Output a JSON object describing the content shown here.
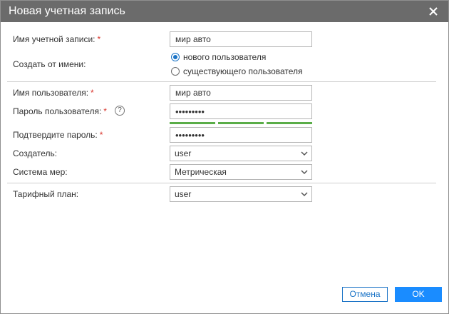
{
  "dialog": {
    "title": "Новая учетная запись",
    "close_icon": "close-icon"
  },
  "form": {
    "account_name": {
      "label": "Имя учетной записи:",
      "required_mark": "*",
      "value": "мир авто"
    },
    "create_from": {
      "label": "Создать от имени:",
      "options": [
        {
          "label": "нового пользователя",
          "selected": true
        },
        {
          "label": "существующего пользователя",
          "selected": false
        }
      ]
    },
    "username": {
      "label": "Имя пользователя:",
      "required_mark": "*",
      "value": "мир авто"
    },
    "password": {
      "label": "Пароль пользователя:",
      "required_mark": "*",
      "help_icon": "question-circle-icon",
      "help_glyph": "?",
      "value": "•••••••••",
      "strength_segments_filled": 3,
      "strength_segments_total": 3
    },
    "confirm_password": {
      "label": "Подтвердите пароль:",
      "required_mark": "*",
      "value": "•••••••••"
    },
    "creator": {
      "label": "Создатель:",
      "selected": "user"
    },
    "measure_system": {
      "label": "Система мер:",
      "selected": "Метрическая"
    },
    "tariff_plan": {
      "label": "Тарифный план:",
      "selected": "user"
    }
  },
  "buttons": {
    "cancel_label": "Отмена",
    "ok_label": "OK"
  },
  "colors": {
    "title_bar": "#6b6b6b",
    "accent": "#1a8cff",
    "required": "#d9342b",
    "strength": "#5aad48"
  }
}
